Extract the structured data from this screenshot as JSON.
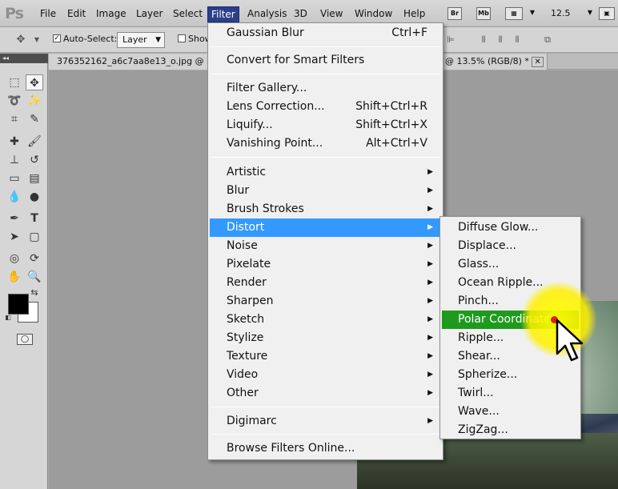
{
  "menubar": {
    "logo": "Ps",
    "items": [
      "File",
      "Edit",
      "Image",
      "Layer",
      "Select",
      "Filter",
      "Analysis",
      "3D",
      "View",
      "Window",
      "Help"
    ],
    "active": "Filter",
    "bridge_btn": "Br",
    "minibridge_btn": "Mb",
    "zoom": "12.5"
  },
  "options": {
    "auto_select_label": "Auto-Select:",
    "auto_select_checked": "✓",
    "layer_select": "Layer",
    "show_label": "Show"
  },
  "documents": {
    "tab1": "376352162_a6c7aa8e13_o.jpg @ 1",
    "tab2": "@ 13.5% (RGB/8) *"
  },
  "filter_menu": {
    "items": [
      {
        "label": "Gaussian Blur",
        "shortcut": "Ctrl+F"
      },
      {
        "label": "Convert for Smart Filters"
      },
      {
        "label": "Filter Gallery..."
      },
      {
        "label": "Lens Correction...",
        "shortcut": "Shift+Ctrl+R"
      },
      {
        "label": "Liquify...",
        "shortcut": "Shift+Ctrl+X"
      },
      {
        "label": "Vanishing Point...",
        "shortcut": "Alt+Ctrl+V"
      },
      {
        "label": "Artistic"
      },
      {
        "label": "Blur"
      },
      {
        "label": "Brush Strokes"
      },
      {
        "label": "Distort"
      },
      {
        "label": "Noise"
      },
      {
        "label": "Pixelate"
      },
      {
        "label": "Render"
      },
      {
        "label": "Sharpen"
      },
      {
        "label": "Sketch"
      },
      {
        "label": "Stylize"
      },
      {
        "label": "Texture"
      },
      {
        "label": "Video"
      },
      {
        "label": "Other"
      },
      {
        "label": "Digimarc"
      },
      {
        "label": "Browse Filters Online..."
      }
    ],
    "highlighted": "Distort"
  },
  "distort_menu": {
    "items": [
      "Diffuse Glow...",
      "Displace...",
      "Glass...",
      "Ocean Ripple...",
      "Pinch...",
      "Polar Coordinates...",
      "Ripple...",
      "Shear...",
      "Spherize...",
      "Twirl...",
      "Wave...",
      "ZigZag..."
    ],
    "highlighted": "Polar Coordinates..."
  },
  "colors": {
    "menu_highlight": "#3399ff",
    "submenu_highlight": "#1e9a1e",
    "cursor_halo": "#ffff00"
  }
}
